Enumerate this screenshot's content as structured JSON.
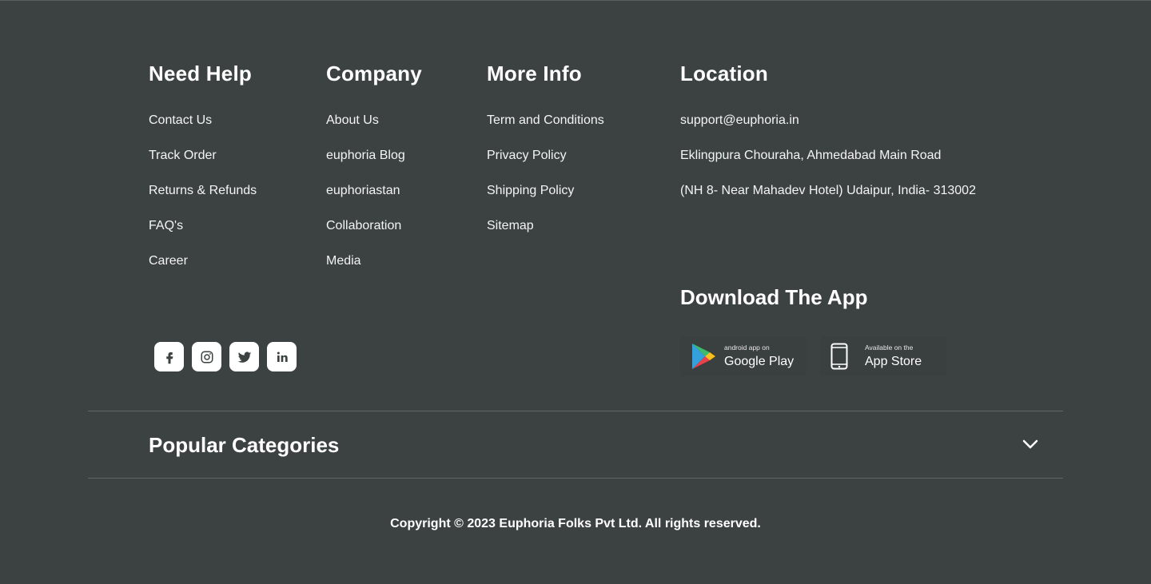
{
  "columns": {
    "help": {
      "title": "Need Help",
      "items": [
        "Contact Us",
        "Track Order",
        "Returns & Refunds",
        "FAQ's",
        "Career"
      ]
    },
    "company": {
      "title": "Company",
      "items": [
        "About Us",
        "euphoria Blog",
        "euphoriastan",
        "Collaboration",
        "Media"
      ]
    },
    "info": {
      "title": "More Info",
      "items": [
        "Term and Conditions",
        "Privacy Policy",
        "Shipping Policy",
        "Sitemap"
      ]
    },
    "location": {
      "title": "Location",
      "items": [
        "support@euphoria.in",
        "Eklingpura Chouraha, Ahmedabad Main Road",
        "(NH 8- Near Mahadev Hotel) Udaipur, India- 313002"
      ]
    }
  },
  "download": {
    "title": "Download The App",
    "google_play": {
      "small": "android app on",
      "big": "Google Play",
      "icon": "google-play-icon"
    },
    "app_store": {
      "small": "Available on the",
      "big": "App Store",
      "icon": "phone-icon"
    }
  },
  "social": [
    "facebook-icon",
    "instagram-icon",
    "twitter-icon",
    "linkedin-icon"
  ],
  "popular": {
    "title": "Popular Categories",
    "icon": "chevron-down-icon"
  },
  "copyright": "Copyright © 2023 Euphoria Folks Pvt Ltd. All rights reserved.",
  "colors": {
    "background": "#3c4242",
    "text": "#ffffff",
    "divider": "#5f6666"
  }
}
